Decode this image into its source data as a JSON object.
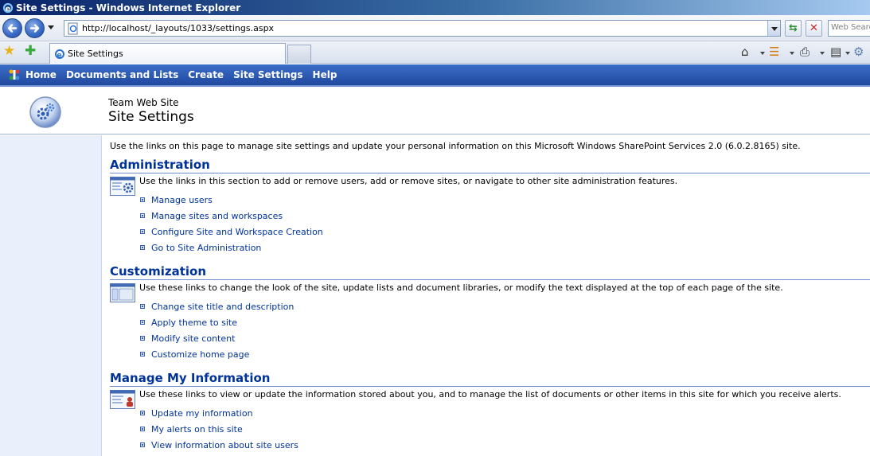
{
  "window": {
    "title": "Site Settings - Windows Internet Explorer"
  },
  "browser": {
    "address_url": "http://localhost/_layouts/1033/settings.aspx",
    "search_placeholder": "Web Search",
    "tab_title": "Site Settings"
  },
  "topnav": {
    "items": [
      "Home",
      "Documents and Lists",
      "Create",
      "Site Settings",
      "Help"
    ]
  },
  "header": {
    "site_name": "Team Web Site",
    "page_title": "Site Settings"
  },
  "main": {
    "intro": "Use the links on this page to manage site settings and update your personal information on this Microsoft Windows SharePoint Services 2.0 (6.0.2.8165) site.",
    "sections": [
      {
        "title": "Administration",
        "description": "Use the links in this section to add or remove users, add or remove sites, or navigate to other site administration features.",
        "links": [
          "Manage users",
          "Manage sites and workspaces",
          "Configure Site and Workspace Creation",
          "Go to Site Administration"
        ]
      },
      {
        "title": "Customization",
        "description": "Use these links to change the look of the site, update lists and document libraries, or modify the text displayed at the top of each page of the site.",
        "links": [
          "Change site title and description",
          "Apply theme to site",
          "Modify site content",
          "Customize home page"
        ]
      },
      {
        "title": "Manage My Information",
        "description": "Use these links to view or update the information stored about you, and to manage the list of documents or other items in this site for which you receive alerts.",
        "links": [
          "Update my information",
          "My alerts on this site",
          "View information about site users"
        ]
      }
    ]
  },
  "colors": {
    "link": "#003399",
    "topnav_bg": "#2a55b0",
    "leftnav_bg": "#eaf0fb"
  }
}
